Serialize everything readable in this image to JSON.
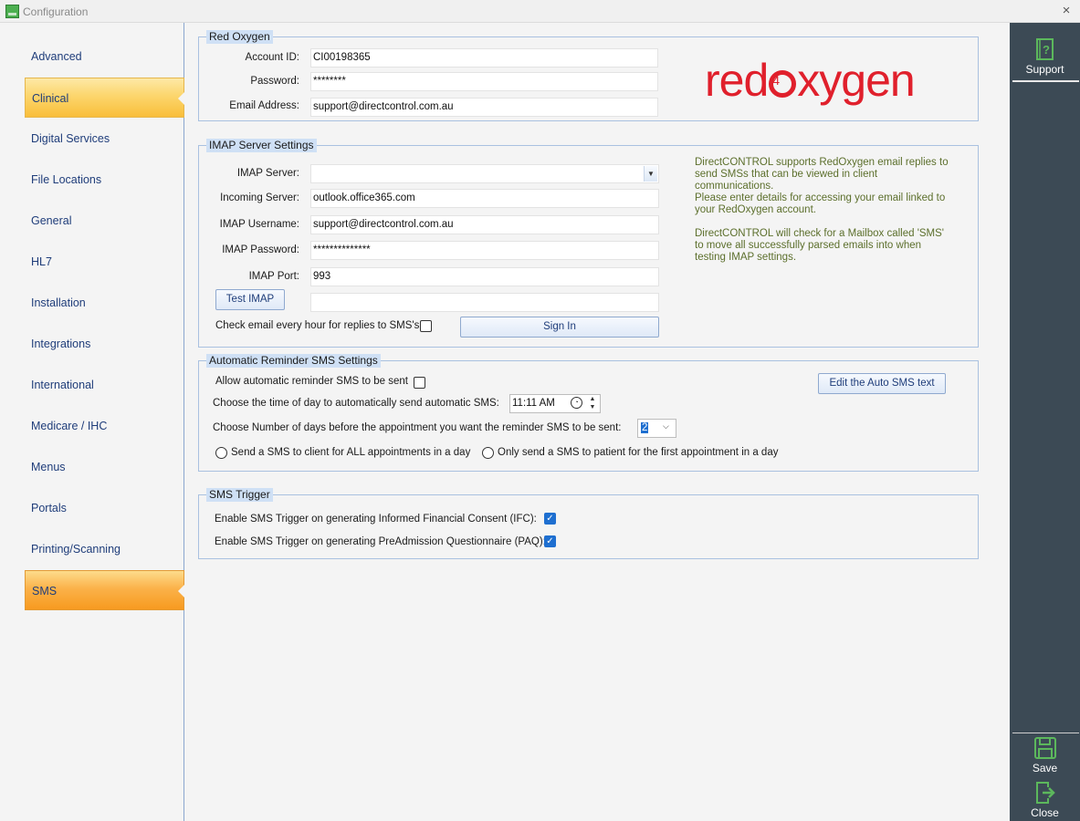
{
  "window": {
    "title": "Configuration",
    "close": "×"
  },
  "sidebar": {
    "items": [
      {
        "label": "Advanced"
      },
      {
        "label": "Clinical"
      },
      {
        "label": "Digital Services"
      },
      {
        "label": "File Locations"
      },
      {
        "label": "General"
      },
      {
        "label": "HL7"
      },
      {
        "label": "Installation"
      },
      {
        "label": "Integrations"
      },
      {
        "label": "International"
      },
      {
        "label": "Medicare / IHC"
      },
      {
        "label": "Menus"
      },
      {
        "label": "Portals"
      },
      {
        "label": "Printing/Scanning"
      },
      {
        "label": "SMS"
      }
    ]
  },
  "red_oxygen": {
    "title": "Red Oxygen",
    "account_label": "Account ID:",
    "account_value": "CI00198365",
    "password_label": "Password:",
    "password_value": "********",
    "email_label": "Email Address:",
    "email_value": "support@directcontrol.com.au",
    "logo_a": "red",
    "logo_b": "4",
    "logo_c": "xygen"
  },
  "imap": {
    "title": "IMAP Server Settings",
    "server_label": "IMAP Server:",
    "server_value": "",
    "incoming_label": "Incoming Server:",
    "incoming_value": "outlook.office365.com",
    "username_label": "IMAP Username:",
    "username_value": "support@directcontrol.com.au",
    "password_label": "IMAP Password:",
    "password_value": "**************",
    "port_label": "IMAP Port:",
    "port_value": "993",
    "test_button": "Test IMAP",
    "test_result": "",
    "check_label": "Check email every hour for replies to SMS's",
    "check_on": false,
    "sign_in_button": "Sign In",
    "info1": "DirectCONTROL supports RedOxygen email replies to send SMSs that can be viewed in client communications.",
    "info2": "Please enter details for accessing your email linked to your RedOxygen account.",
    "info3": "DirectCONTROL will check for a Mailbox called 'SMS' to move all successfully parsed emails into when testing IMAP settings."
  },
  "auto_reminder": {
    "title": "Automatic Reminder SMS Settings",
    "allow_label": "Allow automatic reminder SMS to be sent",
    "allow_on": false,
    "edit_button": "Edit the Auto SMS text",
    "time_label": "Choose the time of day to automatically send automatic SMS:",
    "time_value": "11:11 AM",
    "days_label": "Choose Number of days before the appointment you want the reminder SMS to be sent:",
    "days_value": "2",
    "radio_all": "Send a SMS to client for ALL appointments in a day",
    "radio_first": "Only send a SMS to patient for the first appointment in a day"
  },
  "sms_trigger": {
    "title": "SMS Trigger",
    "ifc_label": "Enable SMS Trigger on generating Informed Financial Consent (IFC):",
    "ifc_on": true,
    "paq_label": "Enable SMS Trigger on generating PreAdmission Questionnaire (PAQ):",
    "paq_on": true
  },
  "rightbar": {
    "support": "Support",
    "save": "Save",
    "close": "Close"
  },
  "colors": {
    "accent": "#f9be3a",
    "nav_text": "#1f3d7a",
    "rightbar_bg": "#3c4a55",
    "icon_green": "#5cb85c",
    "info_text": "#5c6f2c"
  }
}
